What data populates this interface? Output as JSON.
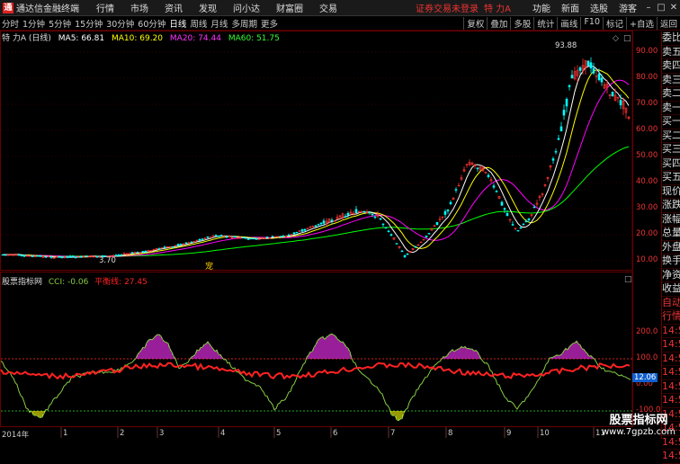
{
  "menubar": {
    "app_title": "通达信金融终端",
    "items": [
      "行情",
      "市场",
      "资讯",
      "发现",
      "问小达",
      "财富圈",
      "交易"
    ],
    "login_status": "证券交易未登录",
    "stock_name": "特 力A",
    "right_items": [
      "功能",
      "新面",
      "选股",
      "游客"
    ],
    "logo_letter": "通"
  },
  "toolbar": {
    "periods": [
      "分时",
      "1分钟",
      "5分钟",
      "15分钟",
      "30分钟",
      "60分钟",
      "日线",
      "周线",
      "月线",
      "多周期",
      "更多"
    ],
    "active_period": "日线",
    "buttons": [
      "复权",
      "叠加",
      "多股",
      "统计",
      "画线",
      "F10",
      "标记",
      "+自选",
      "返回"
    ]
  },
  "main_indicators": {
    "name": "特 力A (日线)",
    "ma5": "MA5: 66.81",
    "ma10": "MA10: 69.20",
    "ma20": "MA20: 74.44",
    "ma60": "MA60: 51.75",
    "high_label": "93.88",
    "low_label": "3.70",
    "marker": "宠"
  },
  "sub_indicators": {
    "name": "股票指标网",
    "cci": "CCI: -0.06",
    "balance": "平衡线: 27.45"
  },
  "price_axis": [
    "90.00",
    "80.00",
    "70.00",
    "60.00",
    "50.00",
    "40.00",
    "30.00",
    "20.00",
    "10.00"
  ],
  "cci_axis": [
    "200.0",
    "100.0",
    "0.00",
    "-100.0"
  ],
  "cci_current": "12.06",
  "x_axis": {
    "year": "2014年",
    "months": [
      "1",
      "2",
      "3",
      "4",
      "5",
      "6",
      "7",
      "8",
      "9",
      "10",
      "11"
    ]
  },
  "sidebar": {
    "items": [
      "委比",
      "卖五",
      "卖四",
      "卖三",
      "卖二",
      "卖一",
      "买一",
      "买二",
      "买三",
      "买四",
      "买五",
      "现价",
      "涨跌",
      "涨幅",
      "总量",
      "外盘",
      "换手",
      "净资",
      "收益",
      "自动",
      "行情",
      "14:5",
      "14:5",
      "14:5",
      "14:5",
      "14:5",
      "14:5",
      "14:5",
      "14:5",
      "14:5",
      "14:5"
    ]
  },
  "watermark": {
    "line1": "股票指标网",
    "line2": "www.7gpzb.com"
  },
  "colors": {
    "ma5": "#ffffff",
    "ma10": "#ffff00",
    "ma20": "#ff00ff",
    "ma60": "#00ff00",
    "up": "#ff3333",
    "down": "#00ffff",
    "cci": "#88cc44",
    "balance": "#ff2222",
    "pink": "#ff33ff"
  }
}
